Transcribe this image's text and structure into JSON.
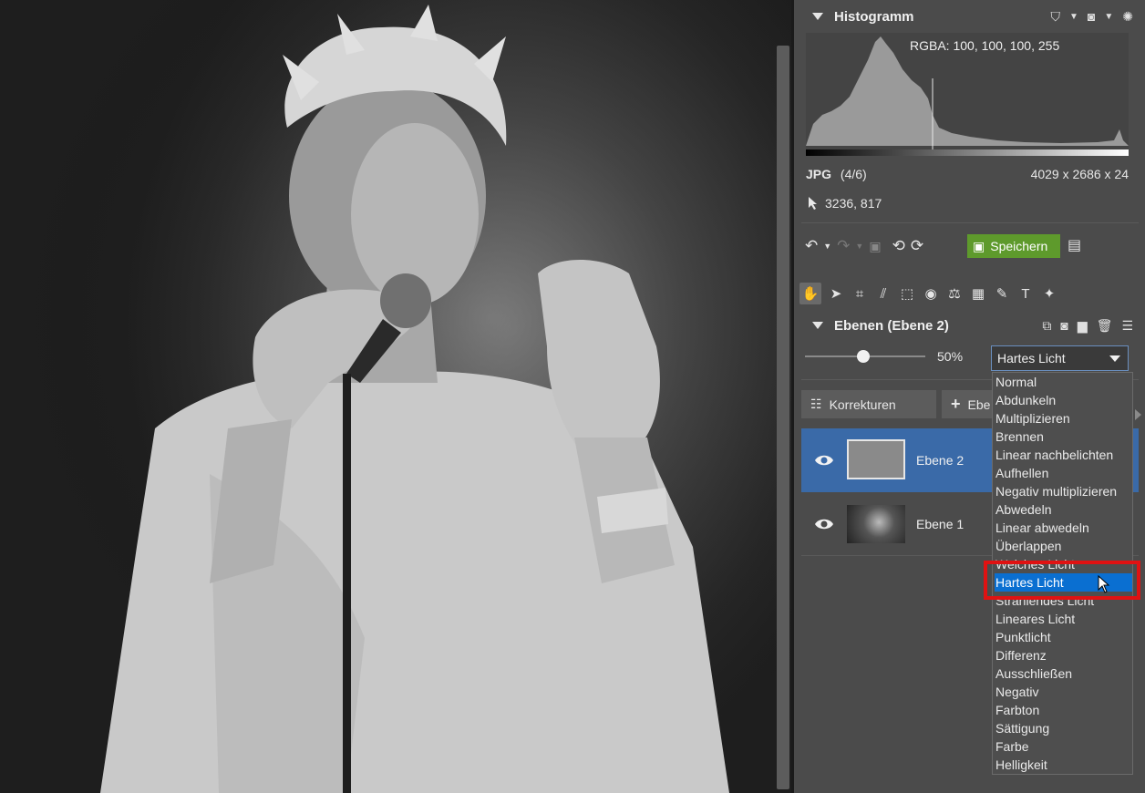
{
  "photo": {
    "description_icon": "photo-canvas"
  },
  "histogram": {
    "title": "Histogramm",
    "rgba": "RGBA: 100, 100, 100, 255",
    "format": "JPG",
    "index": "(4/6)",
    "dimensions": "4029 x 2686 x 24",
    "cursor_coords": "3236, 817"
  },
  "toolbar": {
    "save_label": "Speichern"
  },
  "layers": {
    "title": "Ebenen (Ebene 2)",
    "opacity": "50%",
    "blend_mode": "Hartes Licht",
    "corrections_label": "Korrekturen",
    "add_layer_label": "Ebe",
    "items": [
      {
        "name": "Ebene 2",
        "selected": true
      },
      {
        "name": "Ebene 1",
        "selected": false
      }
    ]
  },
  "blend_options": [
    "Normal",
    "Abdunkeln",
    "Multiplizieren",
    "Brennen",
    "Linear nachbelichten",
    "Aufhellen",
    "Negativ multiplizieren",
    "Abwedeln",
    "Linear abwedeln",
    "Überlappen",
    "Weiches Licht",
    "Hartes Licht",
    "Strahlendes Licht",
    "Lineares Licht",
    "Punktlicht",
    "Differenz",
    "Ausschließen",
    "Negativ",
    "Farbton",
    "Sättigung",
    "Farbe",
    "Helligkeit"
  ],
  "colors": {
    "accent": "#0a6fd1",
    "save_green": "#5e9a2c",
    "selected_layer": "#3a6aa8",
    "highlight_box": "#e01212"
  }
}
